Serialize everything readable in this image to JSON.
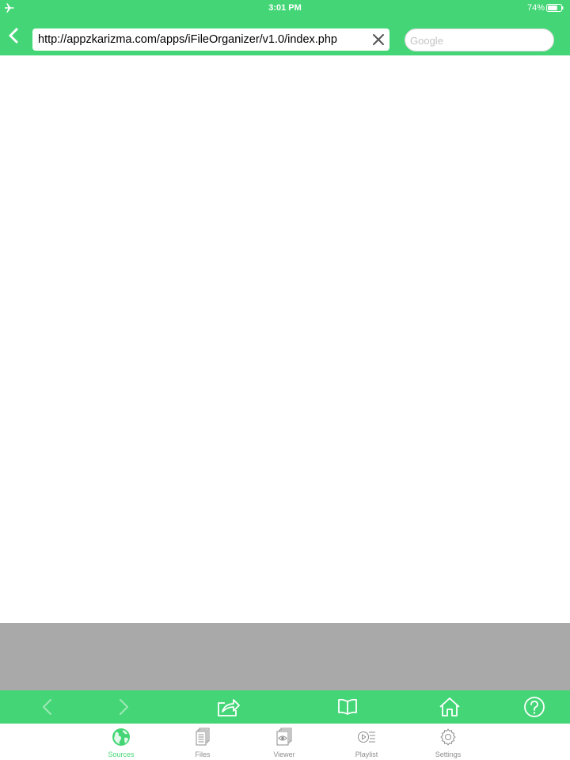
{
  "status_bar": {
    "time": "3:01 PM",
    "battery_percent": "74%",
    "battery_level": 0.74,
    "left_icon": "airplane-icon"
  },
  "nav_bar": {
    "url": "http://appzkarizma.com/apps/iFileOrganizer/v1.0/index.php",
    "search_placeholder": "Google"
  },
  "toolbar": {
    "items": [
      "back-arrow-icon",
      "forward-arrow-icon",
      "share-icon",
      "bookmarks-icon",
      "home-icon",
      "help-icon"
    ]
  },
  "tabs": [
    {
      "label": "Sources",
      "icon": "globe-icon",
      "active": true
    },
    {
      "label": "Files",
      "icon": "files-icon",
      "active": false
    },
    {
      "label": "Viewer",
      "icon": "viewer-icon",
      "active": false
    },
    {
      "label": "Playlist",
      "icon": "playlist-icon",
      "active": false
    },
    {
      "label": "Settings",
      "icon": "gear-icon",
      "active": false
    }
  ],
  "colors": {
    "accent": "#44d676",
    "gray_panel": "#a9a9a9",
    "tab_inactive": "#8e8e8e"
  }
}
